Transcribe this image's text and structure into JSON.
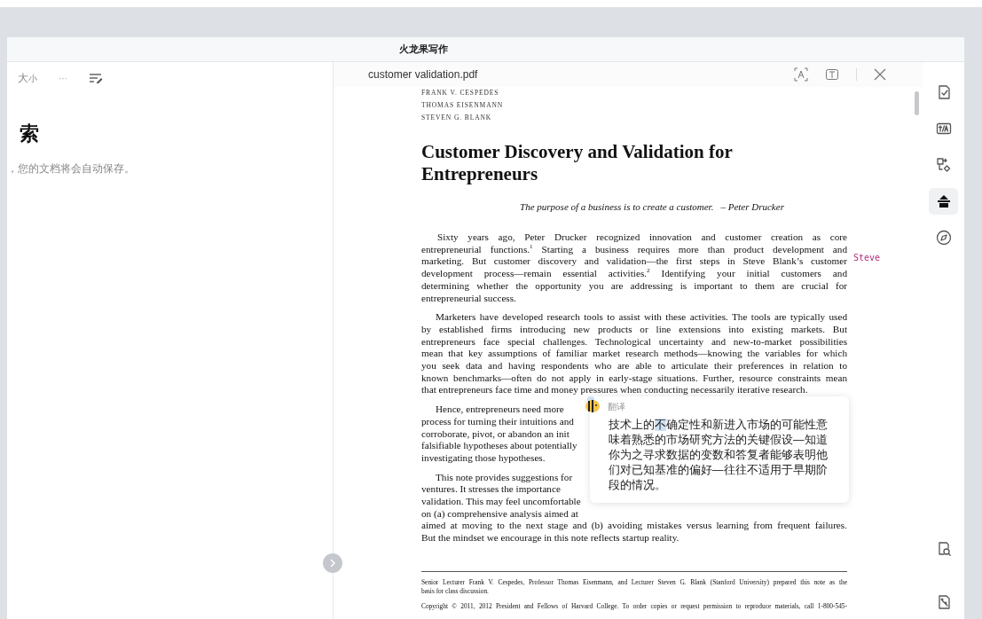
{
  "window": {
    "title": "火龙果写作"
  },
  "editor": {
    "size_big": "大",
    "size_small": "小",
    "more": "···",
    "heading": "索",
    "hint": "，您的文档将会自动保存。"
  },
  "pdf": {
    "filename": "customer validation.pdf",
    "authors": [
      "FRANK V. CESPEDES",
      "THOMAS EISENMANN",
      "STEVEN G. BLANK"
    ],
    "title": "Customer Discovery and Validation for Entrepreneurs",
    "epigraph": {
      "quote": "The purpose of a business is to create a customer.",
      "attribution": "– Peter Drucker"
    },
    "paragraphs": [
      {
        "lines": [
          {
            "text": "Sixty years ago, Peter Drucker recognized innovation and customer creation as core",
            "kind": "full"
          },
          {
            "text": "entrepreneurial functions.$^{1}$ Starting a business requires more than product development and",
            "kind": "full"
          },
          {
            "text": "marketing. But customer discovery and validation—the first steps in Steve Blank’s customer",
            "kind": "full"
          },
          {
            "text": "development process—remain essential activities.$^{2}$ Identifying your initial customers and",
            "kind": "full"
          },
          {
            "text": "determining whether the opportunity you are addressing is important to them are crucial for",
            "kind": "full"
          },
          {
            "text": "entrepreneurial success.",
            "kind": "end"
          }
        ]
      },
      {
        "lines": [
          {
            "text": "Marketers have developed research tools to assist with these activities. The tools are typically used",
            "kind": "full"
          },
          {
            "text": "by established firms introducing new products or line extensions into existing markets. But",
            "kind": "full"
          },
          {
            "text": "entrepreneurs face special challenges. Technological uncertainty and new-to-market possibilities",
            "kind": "full"
          },
          {
            "text": "mean that key assumptions of familiar market research methods—knowing the variables for which",
            "kind": "full"
          },
          {
            "text": "you seek data and having respondents who are able to articulate their preferences in relation to",
            "kind": "full"
          },
          {
            "text": "known benchmarks—often do not apply in early-stage situations. Further, resource constraints mean",
            "kind": "full"
          },
          {
            "text": "that entrepreneurs face time and money pressures when conducting necessarily iterative research.",
            "kind": "end"
          }
        ]
      },
      {
        "lines": [
          {
            "text": "Hence, entrepreneurs need more",
            "kind": "cut"
          },
          {
            "text": "process for turning their intuitions and",
            "kind": "cut"
          },
          {
            "text": "corroborate, pivot, or abandon an init",
            "kind": "cut"
          },
          {
            "text": "falsifiable hypotheses about potentially",
            "kind": "cut"
          },
          {
            "text": "investigating those hypotheses.",
            "kind": "end"
          }
        ]
      },
      {
        "lines": [
          {
            "text": "This note provides suggestions for",
            "kind": "cut"
          },
          {
            "text": "ventures. It stresses the importance",
            "kind": "cut"
          },
          {
            "text": "validation. This may feel uncomfortable",
            "kind": "cut"
          },
          {
            "text": "on (a) comprehensive analysis aimed at",
            "kind": "cut"
          },
          {
            "text": "aimed at moving to the next stage and (b) avoiding mistakes versus learning from frequent failures.",
            "kind": "full"
          },
          {
            "text": "But the mindset we encourage in this note reflects startup reality.",
            "kind": "end"
          }
        ]
      }
    ],
    "margin_note": "Steve",
    "footnotes": [
      {
        "lines": [
          {
            "text": "Senior Lecturer Frank V. Cespedes, Professor Thomas Eisenmann, and Lecturer Steven G. Blank (Stanford University) prepared this note as the",
            "kind": "full"
          },
          {
            "text": "basis for class discussion.",
            "kind": "end"
          }
        ]
      },
      {
        "lines": [
          {
            "text": "Copyright © 2011, 2012 President and Fellows of Harvard College.  To order copies or request permission to reproduce materials, call 1-800-545-",
            "kind": "full"
          }
        ]
      }
    ]
  },
  "translation_popup": {
    "label": "翻译",
    "lines": [
      {
        "segments": [
          {
            "text": "技术上的",
            "highlighted": false
          },
          {
            "text": "不",
            "highlighted": true
          },
          {
            "text": "确定性和新进入市场的可能性意",
            "highlighted": false
          }
        ]
      },
      {
        "segments": [
          {
            "text": "味着熟悉的市场研究方法的关键假设—知道",
            "highlighted": false
          }
        ]
      },
      {
        "segments": [
          {
            "text": "你为之寻求数据的变数和答复者能够表明他",
            "highlighted": false
          }
        ]
      },
      {
        "segments": [
          {
            "text": "们对已知基准的偏好—往往不适用于早期阶",
            "highlighted": false
          }
        ]
      },
      {
        "segments": [
          {
            "text": "段的情况。",
            "highlighted": false
          }
        ]
      }
    ]
  },
  "sidebar": {
    "tools": [
      {
        "kind": "check-doc",
        "selected": false
      },
      {
        "kind": "translate",
        "selected": false
      },
      {
        "kind": "flow",
        "selected": false
      },
      {
        "kind": "hat",
        "selected": true
      },
      {
        "kind": "compass",
        "selected": false
      }
    ],
    "bottom_tools": [
      {
        "kind": "doc-search",
        "selected": false
      },
      {
        "kind": "doc-magic",
        "selected": false
      }
    ]
  }
}
